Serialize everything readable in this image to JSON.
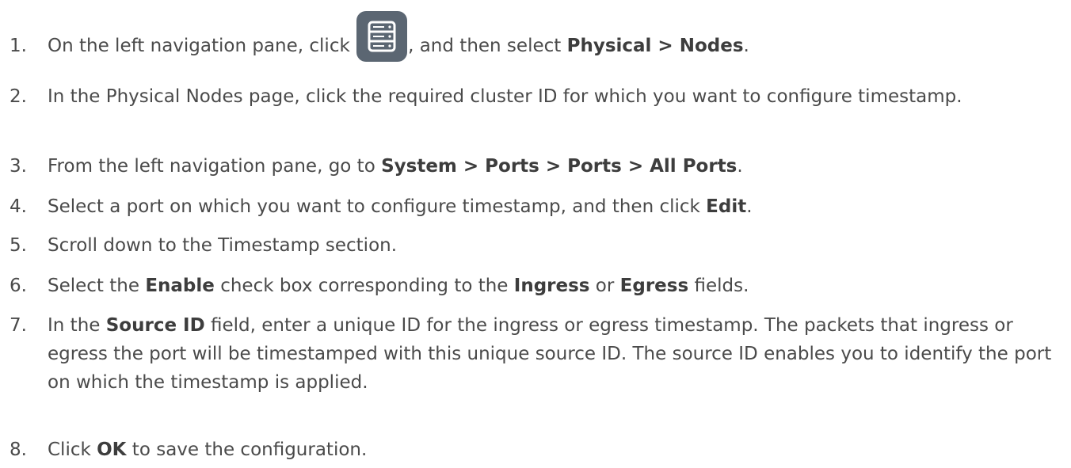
{
  "steps": [
    {
      "number": "1.",
      "parts": [
        {
          "text": "On the left navigation pane, click "
        },
        {
          "icon": "server-icon"
        },
        {
          "text": ", and then select "
        },
        {
          "text": "Physical > Nodes",
          "bold": true
        },
        {
          "text": "."
        }
      ]
    },
    {
      "number": "2.",
      "parts": [
        {
          "text": "In the Physical Nodes page, click the required cluster ID for which you want to configure timestamp."
        }
      ]
    },
    {
      "number": "3.",
      "parts": [
        {
          "text": "From the left navigation pane, go to "
        },
        {
          "text": "System > Ports > Ports > All Ports",
          "bold": true
        },
        {
          "text": "."
        }
      ]
    },
    {
      "number": "4.",
      "parts": [
        {
          "text": "Select a port on which you want to configure timestamp, and then click "
        },
        {
          "text": "Edit",
          "bold": true
        },
        {
          "text": "."
        }
      ]
    },
    {
      "number": "5.",
      "parts": [
        {
          "text": "Scroll down to the Timestamp section."
        }
      ]
    },
    {
      "number": "6.",
      "parts": [
        {
          "text": "Select the "
        },
        {
          "text": "Enable",
          "bold": true
        },
        {
          "text": " check box corresponding to the "
        },
        {
          "text": "Ingress",
          "bold": true
        },
        {
          "text": " or "
        },
        {
          "text": "Egress",
          "bold": true
        },
        {
          "text": " fields."
        }
      ]
    },
    {
      "number": "7.",
      "parts": [
        {
          "text": "In the "
        },
        {
          "text": "Source ID",
          "bold": true
        },
        {
          "text": " field, enter a unique ID for the ingress or egress timestamp. The packets that ingress or egress the port will be timestamped with this unique source ID. The source ID enables you to identify the port on which the timestamp is applied."
        }
      ]
    },
    {
      "number": "8.",
      "parts": [
        {
          "text": "Click "
        },
        {
          "text": "OK",
          "bold": true
        },
        {
          "text": " to save the configuration."
        }
      ]
    }
  ],
  "colors": {
    "text": "#4a4a4a",
    "icon_bg": "#5b6672",
    "icon_fg": "#ffffff"
  }
}
